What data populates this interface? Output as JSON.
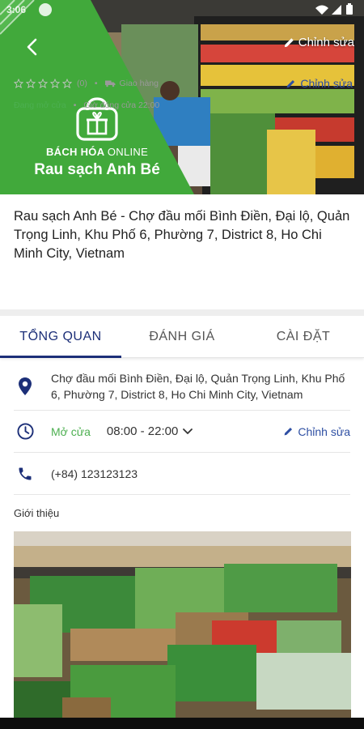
{
  "status_bar": {
    "time": "3:06"
  },
  "header": {
    "back_icon": "arrow-back-icon",
    "edit_label": "Chỉnh sửa",
    "brand_line_bold": "BÁCH HÓA",
    "brand_line_light": "ONLINE",
    "brand_name": "Rau sạch Anh Bé",
    "brand_icon": "gift-basket-icon"
  },
  "store": {
    "title": "Rau sạch Anh Bé - Chợ đầu mối Bình Điền, Đại lộ, Quản Trọng Linh, Khu Phố 6, Phường 7, District 8, Ho Chi Minh City, Vietnam",
    "rating_stars": 0,
    "rating_count": "(0)",
    "delivery_label": "Giao hàng",
    "edit_label": "Chỉnh sửa",
    "open_status": "Đang mở cửa",
    "closing_time": "Giờ đóng cửa 22:00"
  },
  "tabs": [
    {
      "label": "TỔNG QUAN",
      "active": true
    },
    {
      "label": "ĐÁNH GIÁ",
      "active": false
    },
    {
      "label": "CÀI ĐẶT",
      "active": false
    }
  ],
  "details": {
    "address": "Chợ đầu mối Bình Điền, Đại lộ, Quản Trọng Linh, Khu Phố 6, Phường 7, District 8, Ho Chi Minh City, Vietnam",
    "hours_status": "Mở cửa",
    "hours_range": "08:00 - 22:00",
    "hours_edit_label": "Chỉnh sửa",
    "phone": "(+84) 123123123"
  },
  "intro": {
    "label": "Giới thiệu"
  },
  "colors": {
    "brand_green": "#41a93b",
    "accent_blue": "#1c2f78",
    "link_blue": "#2e4fa3",
    "open_green": "#4caf50"
  }
}
